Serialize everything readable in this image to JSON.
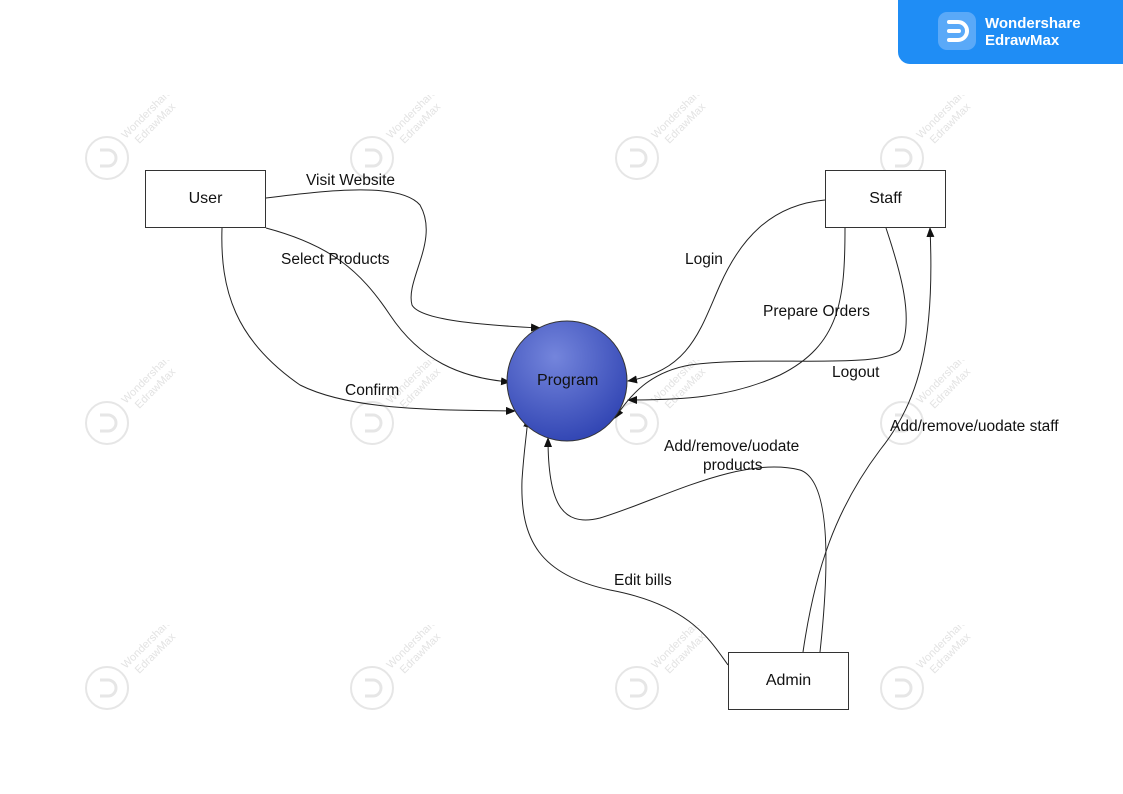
{
  "brand": {
    "line1": "Wondershare",
    "line2": "EdrawMax"
  },
  "watermark": {
    "line1": "Wondershare",
    "line2": "EdrawMax"
  },
  "nodes": {
    "user": "User",
    "staff": "Staff",
    "admin": "Admin",
    "program": "Program"
  },
  "edges": {
    "visit_website": "Visit Website",
    "select_products": "Select Products",
    "confirm": "Confirm",
    "login": "Login",
    "prepare_orders": "Prepare Orders",
    "logout": "Logout",
    "add_products_line1": "Add/remove/uodate",
    "add_products_line2": "products",
    "add_staff": "Add/remove/uodate staff",
    "edit_bills": "Edit bills"
  },
  "colors": {
    "brand_bg": "#1f8df5",
    "program_fill_top": "#6f7fd8",
    "program_fill_bottom": "#3447b8"
  }
}
